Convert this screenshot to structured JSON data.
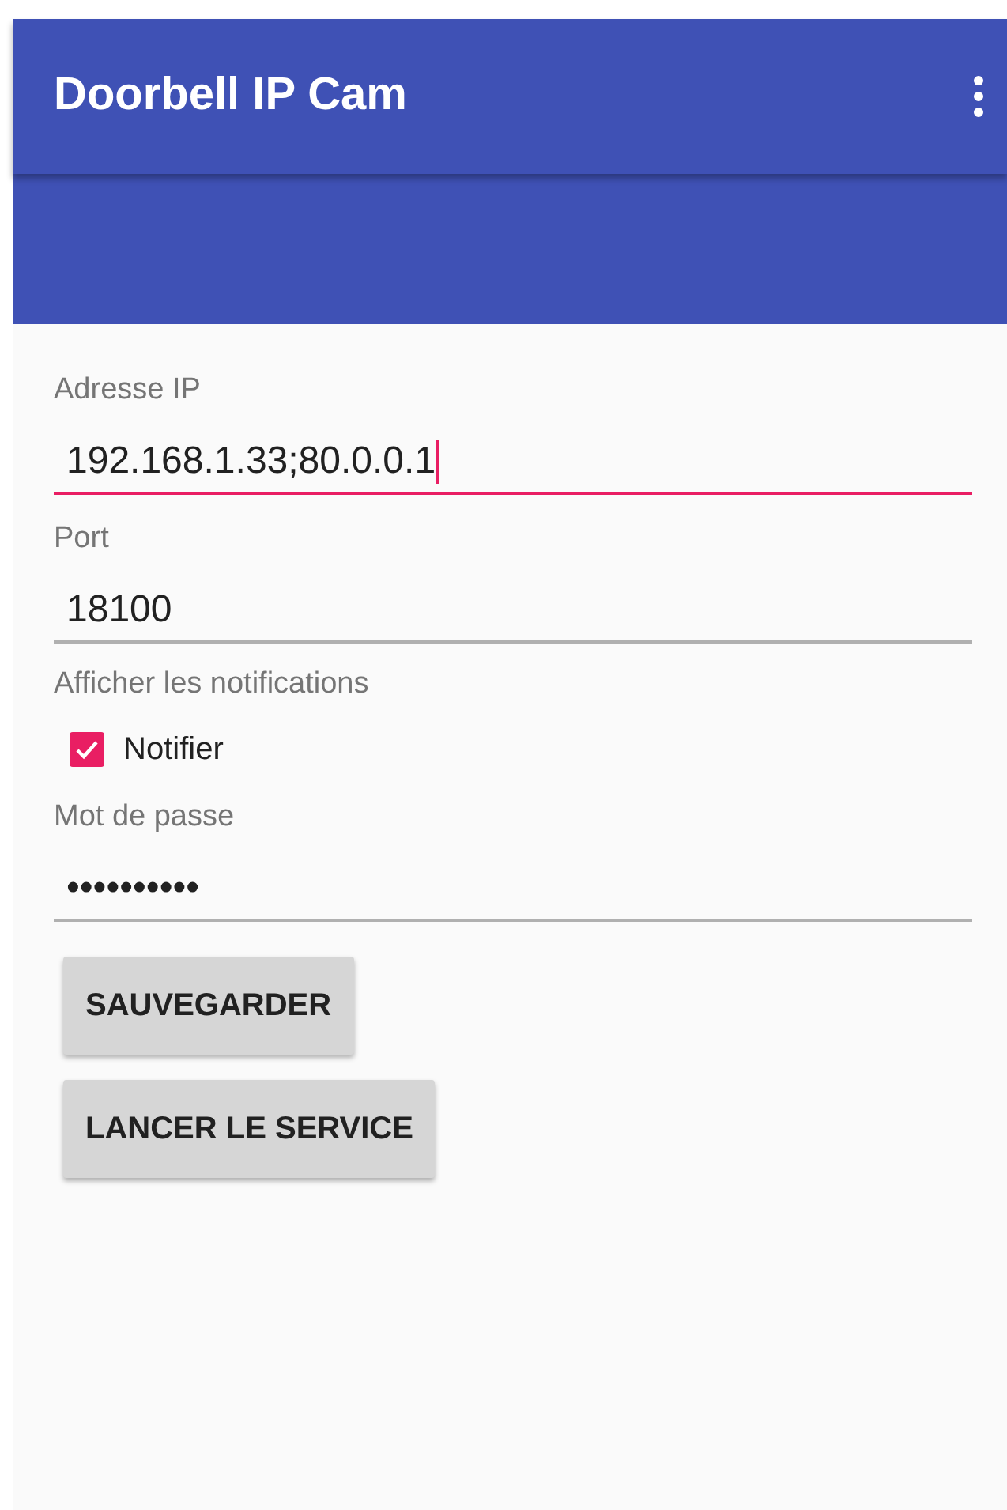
{
  "app_bar": {
    "title": "Doorbell IP Cam"
  },
  "fields": [
    {
      "kind": "text",
      "label": "Adresse IP",
      "value": "192.168.1.33;80.0.0.1",
      "focused": true
    },
    {
      "kind": "text",
      "label": "Port",
      "value": "18100",
      "focused": false
    },
    {
      "kind": "checkbox",
      "label": "Afficher les notifications",
      "option": "Notifier",
      "checked": true
    },
    {
      "kind": "text",
      "label": "Mot de passe",
      "value": "••••••••••",
      "focused": false
    }
  ],
  "buttons": [
    "SAUVEGARDER",
    "LANCER LE SERVICE"
  ]
}
